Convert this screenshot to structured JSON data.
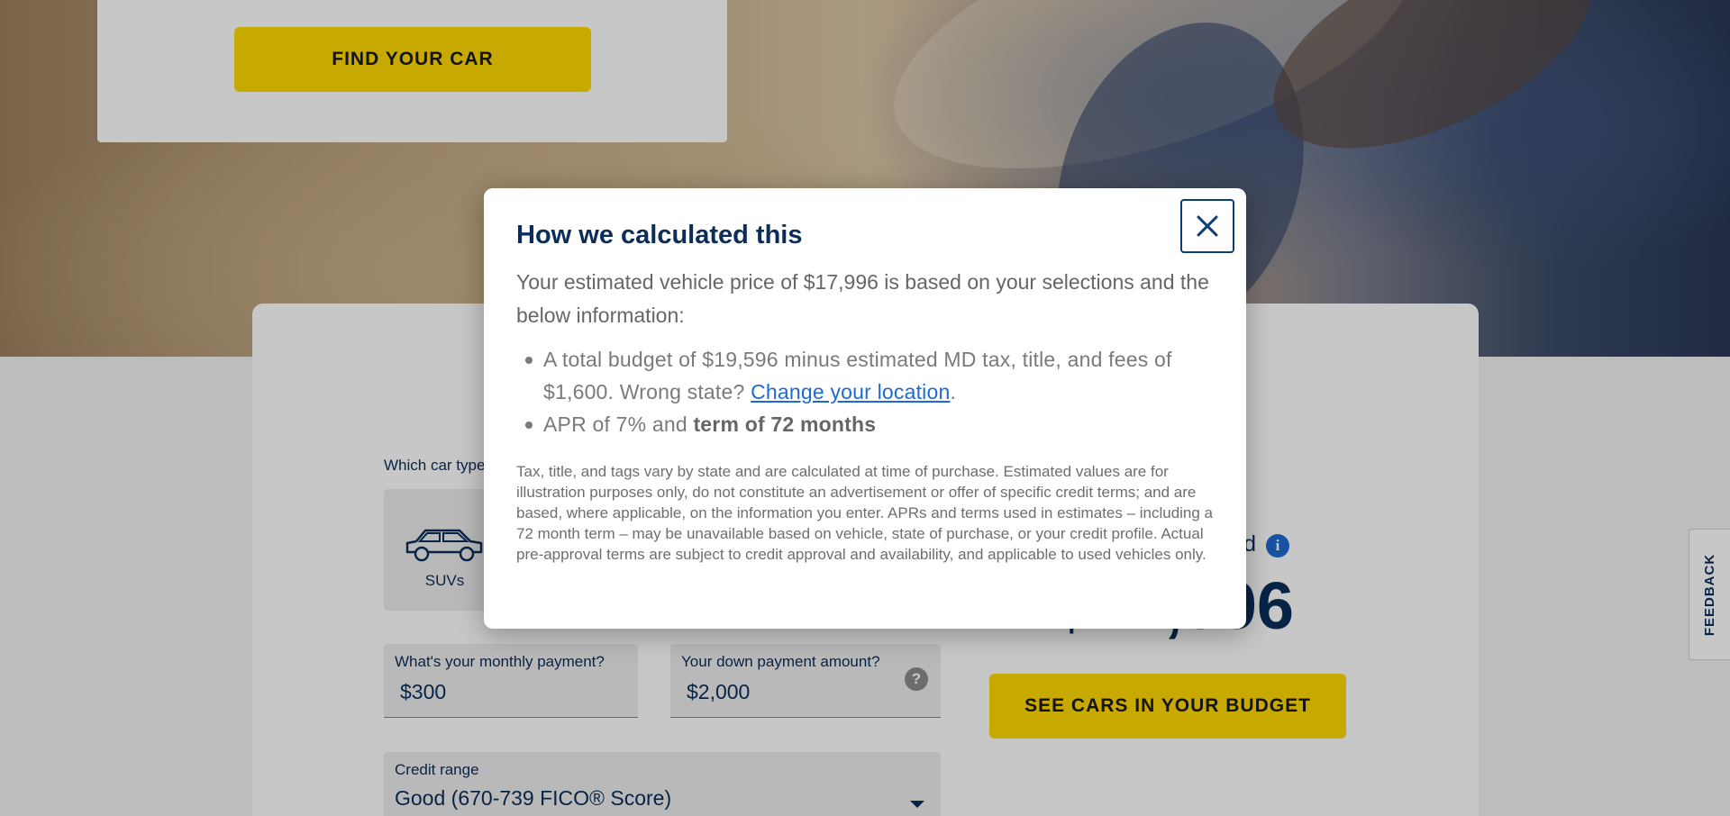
{
  "hero": {
    "find_button": "FIND YOUR CAR"
  },
  "calculator": {
    "car_type_label": "Which car type",
    "car_types": [
      {
        "label": "SUVs",
        "icon": "suv-icon"
      }
    ],
    "monthly": {
      "label": "What's your monthly payment?",
      "value": "$300"
    },
    "down": {
      "label": "Your down payment amount?",
      "value": "$2,000",
      "help_icon": "?"
    },
    "credit": {
      "label": "Credit range",
      "value": "Good (670-739 FICO® Score)"
    },
    "budget_label": "d",
    "info_icon": "i",
    "price": "$17,996",
    "see_button": "SEE CARS IN YOUR BUDGET"
  },
  "feedback": {
    "label": "FEEDBACK"
  },
  "modal": {
    "title": "How we calculated this",
    "intro": "Your estimated vehicle price of $17,996 is based on your selections and the below information:",
    "bullet1_text": "A total budget of $19,596 minus estimated MD tax, title, and fees of $1,600. Wrong state? ",
    "bullet1_link": "Change your location",
    "bullet1_end": ".",
    "bullet2_text": "APR of 7% and ",
    "bullet2_bold": "term of 72 months",
    "disclaimer": "Tax, title, and tags vary by state and are calculated at time of purchase. Estimated values are for illustration purposes only, do not constitute an advertisement or offer of specific credit terms; and are based, where applicable, on the information you enter. APRs and terms used in estimates – including a 72 month term – may be unavailable based on vehicle, state of purchase, or your credit profile. Actual pre-approval terms are subject to credit approval and availability, and applicable to used vehicles only."
  },
  "colors": {
    "navy": "#0a2d5a",
    "yellow": "#ffd900",
    "link_blue": "#1f6ad0"
  }
}
